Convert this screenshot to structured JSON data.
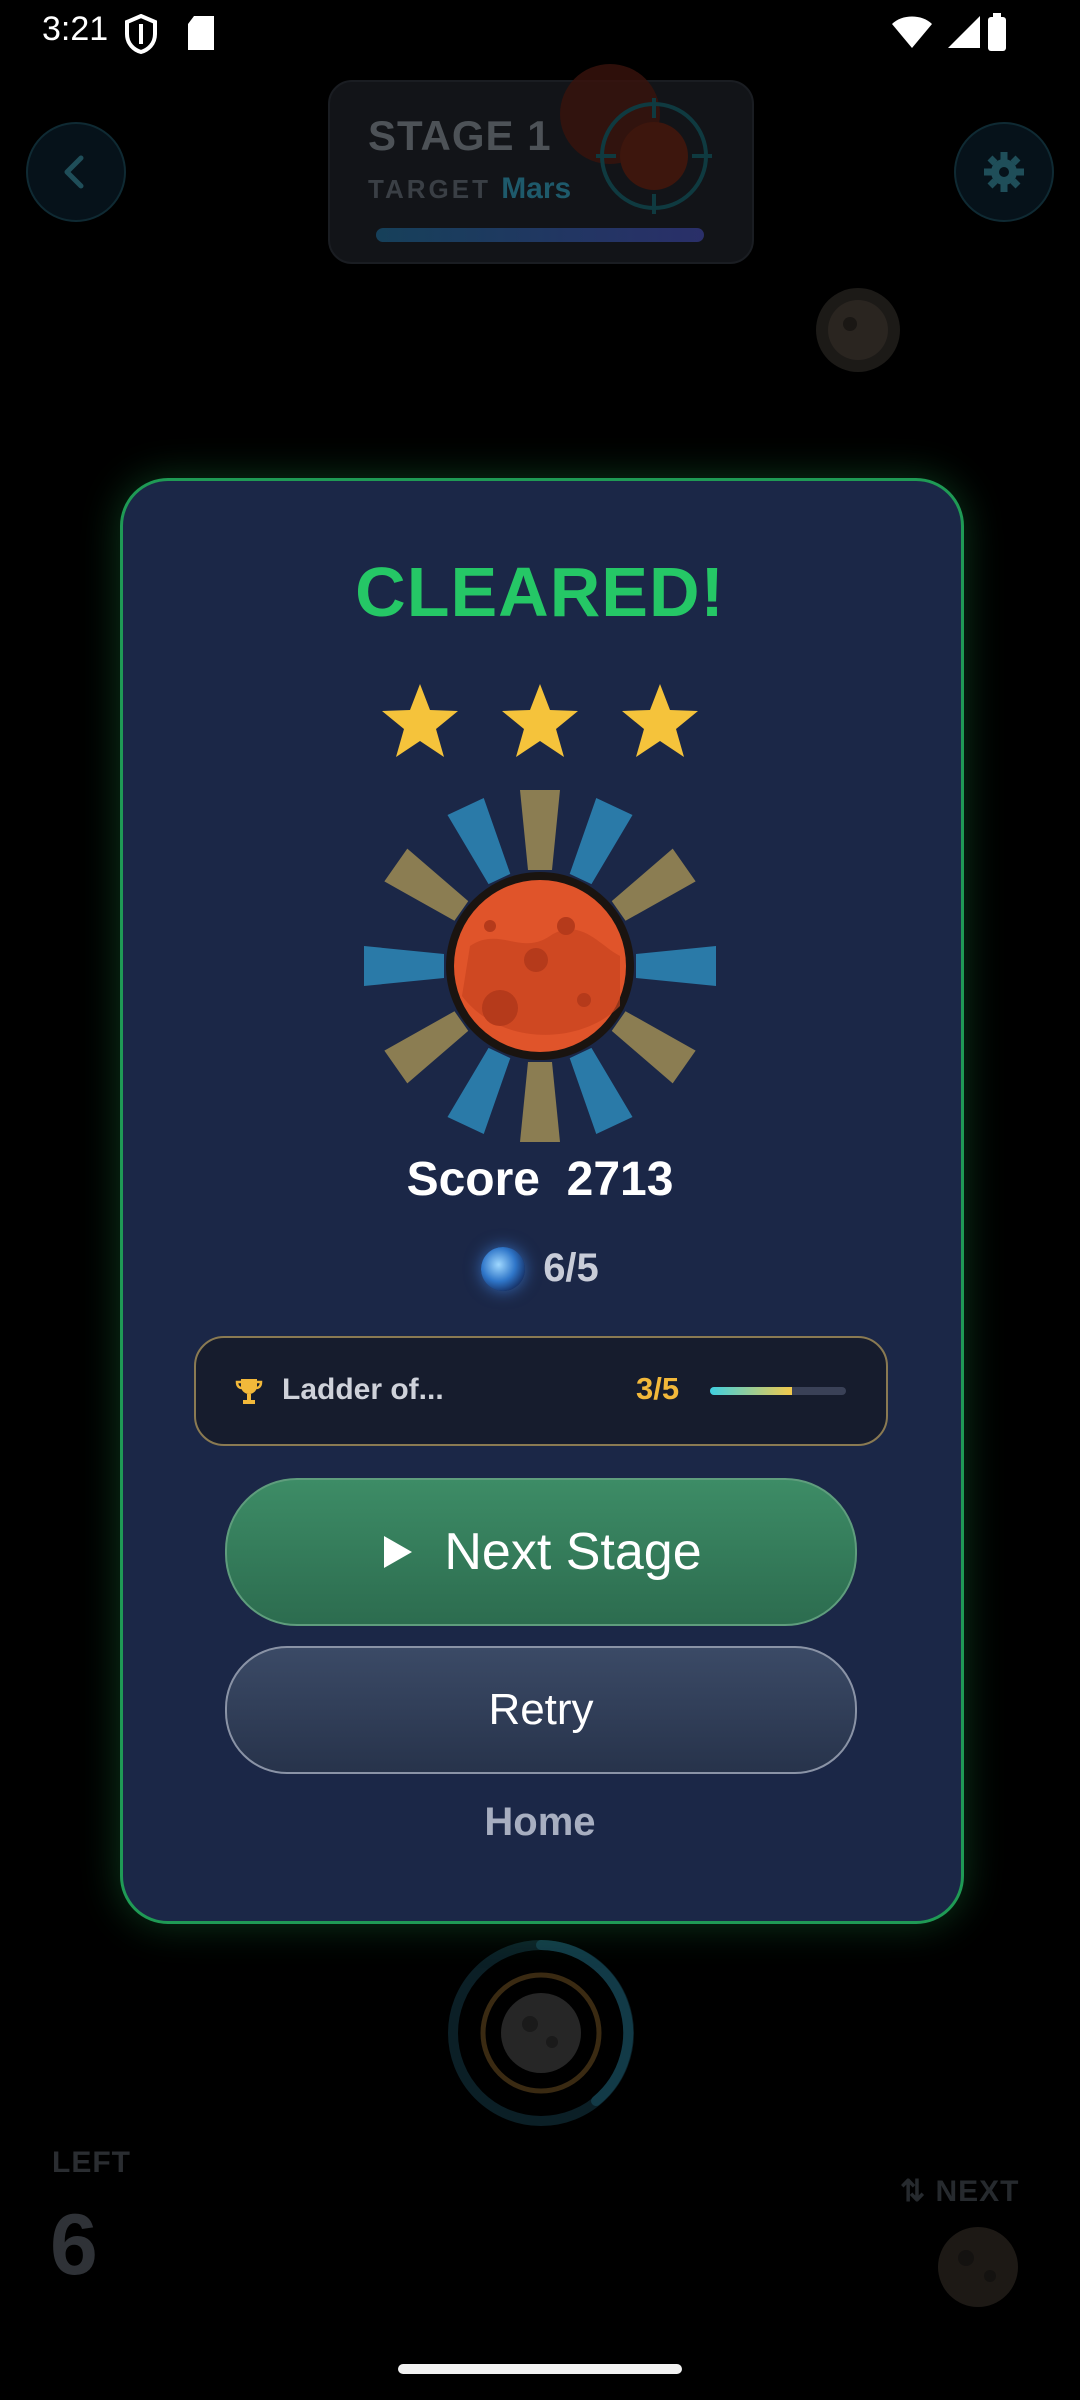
{
  "status_bar": {
    "time": "3:21"
  },
  "background": {
    "stage_title": "STAGE 1",
    "target_label": "TARGET",
    "target_name": "Mars",
    "left_label": "LEFT",
    "left_value": "6",
    "next_label": "⇅ NEXT"
  },
  "modal": {
    "title": "CLEARED!",
    "stars_earned": 3,
    "stars_total": 3,
    "score_label": "Score",
    "score_value": "2713",
    "orbs_text": "6/5",
    "challenge": {
      "name": "Ladder of...",
      "count": "3/5",
      "progress": 0.6
    },
    "next_button": "Next Stage",
    "retry_button": "Retry",
    "home_link": "Home"
  },
  "colors": {
    "accent_green": "#25c766",
    "modal_bg": "#1b2747",
    "star": "#f5c33b",
    "challenge_count": "#f2b83a"
  },
  "icons": [
    "back-arrow-icon",
    "gear-icon",
    "star-icon",
    "mars-planet-icon",
    "orb-icon",
    "trophy-icon",
    "play-icon",
    "moon-icon",
    "asteroid-icon"
  ]
}
